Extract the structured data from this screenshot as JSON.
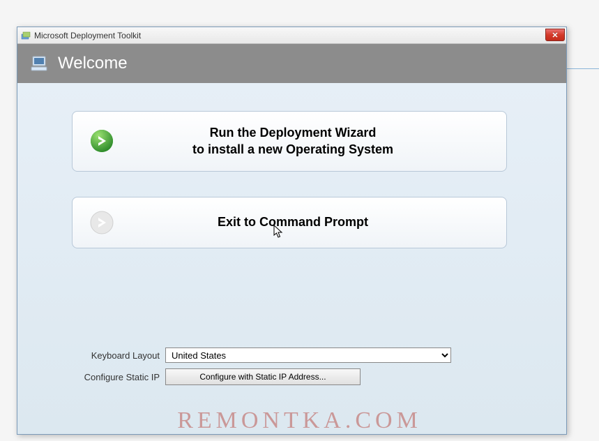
{
  "titlebar": {
    "text": "Microsoft Deployment Toolkit"
  },
  "header": {
    "title": "Welcome"
  },
  "options": {
    "run_wizard": "Run the Deployment Wizard\nto install a new Operating System",
    "exit_cmd": "Exit to Command Prompt"
  },
  "form": {
    "keyboard_label": "Keyboard Layout",
    "keyboard_value": "United States",
    "static_ip_label": "Configure Static IP",
    "static_ip_button": "Configure with Static IP Address..."
  },
  "watermark": "REMONTKA.COM"
}
